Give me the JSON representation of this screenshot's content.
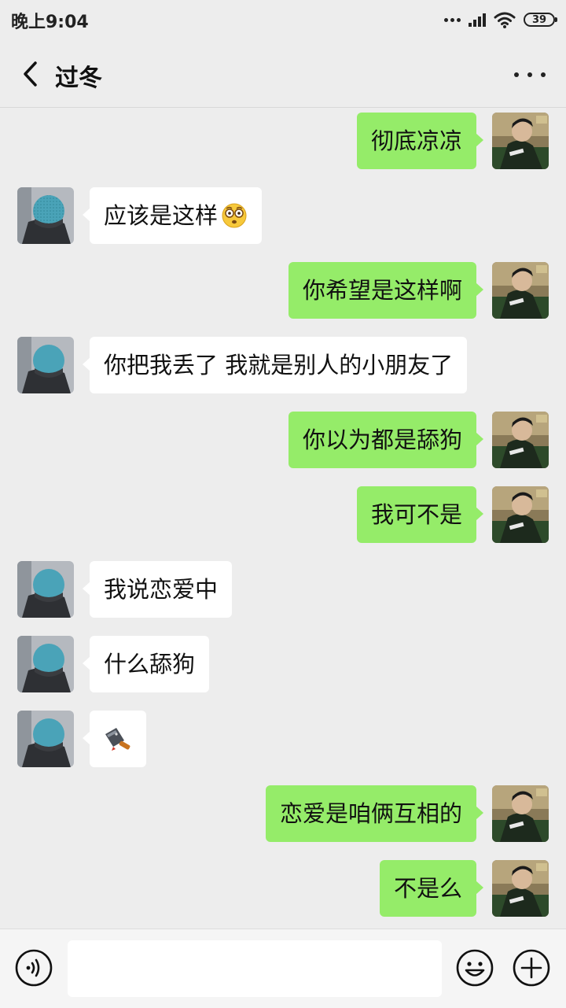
{
  "status_bar": {
    "time": "晚上9:04",
    "battery": "39"
  },
  "header": {
    "title": "过冬",
    "back_icon": "chevron-left-icon",
    "more_icon": "more-horizontal-icon"
  },
  "messages": [
    {
      "side": "sent",
      "text": "彻底凉凉"
    },
    {
      "side": "received",
      "text": "应该是这样",
      "emoji": "nerd-face-emoji"
    },
    {
      "side": "sent",
      "text": "你希望是这样啊"
    },
    {
      "side": "received",
      "text": "你把我丢了 我就是别人的小朋友了"
    },
    {
      "side": "sent",
      "text": "你以为都是舔狗"
    },
    {
      "side": "sent",
      "text": "我可不是"
    },
    {
      "side": "received",
      "text": "我说恋爱中"
    },
    {
      "side": "received",
      "text": "什么舔狗"
    },
    {
      "side": "received",
      "sticker": "cleaver-knife-emoji"
    },
    {
      "side": "sent",
      "text": "恋爱是咱俩互相的"
    },
    {
      "side": "sent",
      "text": "不是么"
    }
  ],
  "input_bar": {
    "voice_icon": "voice-icon",
    "emoji_icon": "smiley-icon",
    "plus_icon": "plus-circle-icon",
    "input_value": ""
  },
  "colors": {
    "sent_bubble": "#95ec69",
    "received_bubble": "#ffffff",
    "background": "#ededed"
  }
}
